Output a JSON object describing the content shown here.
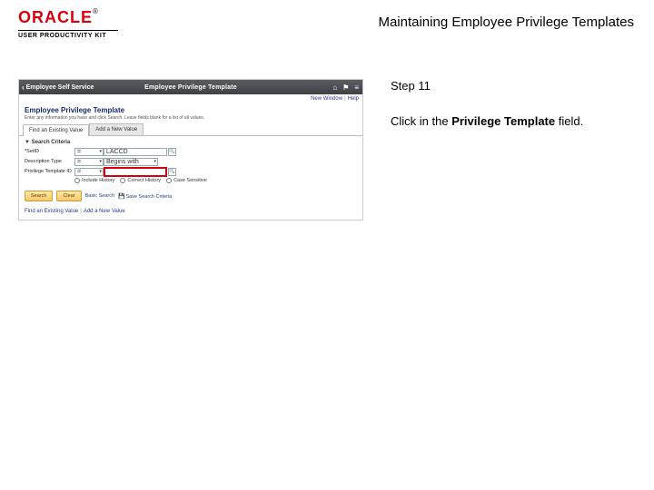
{
  "header": {
    "brand_name": "ORACLE",
    "brand_tm": "®",
    "product_line": "USER PRODUCTIVITY KIT",
    "title": "Maintaining Employee Privilege Templates"
  },
  "instruction_panel": {
    "step_label": "Step 11",
    "text_before": "Click in the ",
    "text_bold": "Privilege Template",
    "text_after": " field."
  },
  "app": {
    "topbar": {
      "back_label": "Employee Self Service",
      "title": "Employee Privilege Template",
      "icons": {
        "home": "home-icon",
        "flag": "flag-icon",
        "menu": "menu-icon"
      }
    },
    "sublinks": {
      "new_window": "New Window",
      "help": "Help"
    },
    "section": {
      "title": "Employee Privilege Template",
      "subtitle": "Enter any information you have and click Search. Leave fields blank for a list of all values."
    },
    "tabs": {
      "find": "Find an Existing Value",
      "add": "Add a New Value"
    },
    "criteria": {
      "heading": "Search Criteria",
      "rows": {
        "setid": {
          "label": "*SetID",
          "op": "=",
          "value": "LACCD"
        },
        "desc_type": {
          "label": "Description Type",
          "op": "=",
          "value": "Begins with"
        },
        "priv_template": {
          "label": "Privilege Template ID",
          "op": "=",
          "value": ""
        }
      },
      "radios": {
        "include_history": "Include History",
        "correct_history": "Correct History",
        "case_sensitive": "Case Sensitive"
      }
    },
    "buttons": {
      "search": "Search",
      "clear": "Clear",
      "basic": "Basic Search",
      "save": "Save Search Criteria"
    },
    "footer": {
      "find": "Find an Existing Value",
      "add": "Add a New Value"
    }
  }
}
